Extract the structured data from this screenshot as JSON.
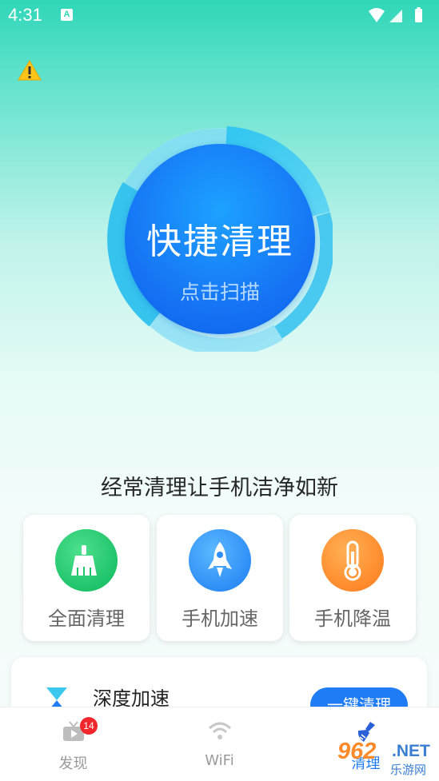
{
  "status_bar": {
    "time": "4:31",
    "notification_letter": "A"
  },
  "hero": {
    "title": "快捷清理",
    "subtitle": "点击扫描"
  },
  "tagline": "经常清理让手机洁净如新",
  "features": [
    {
      "label": "全面清理",
      "icon": "broom-icon",
      "color": "#1fc46a"
    },
    {
      "label": "手机加速",
      "icon": "rocket-icon",
      "color": "#2f8ef6"
    },
    {
      "label": "手机降温",
      "icon": "thermometer-icon",
      "color": "#ff8a2b"
    }
  ],
  "deep_boost": {
    "title": "深度加速",
    "button": "一键清理"
  },
  "nav": {
    "tabs": [
      {
        "label": "发现",
        "icon": "tv-icon",
        "badge": "14"
      },
      {
        "label": "WiFi",
        "icon": "wifi-icon"
      },
      {
        "label": "清理",
        "icon": "broom-icon",
        "active": true
      }
    ]
  },
  "watermark": {
    "number": "962",
    "net": ".NET",
    "chinese": "乐游网"
  },
  "colors": {
    "accent": "#1f7cf5",
    "teal": "#2fd6b8",
    "badge": "#f2262d"
  }
}
